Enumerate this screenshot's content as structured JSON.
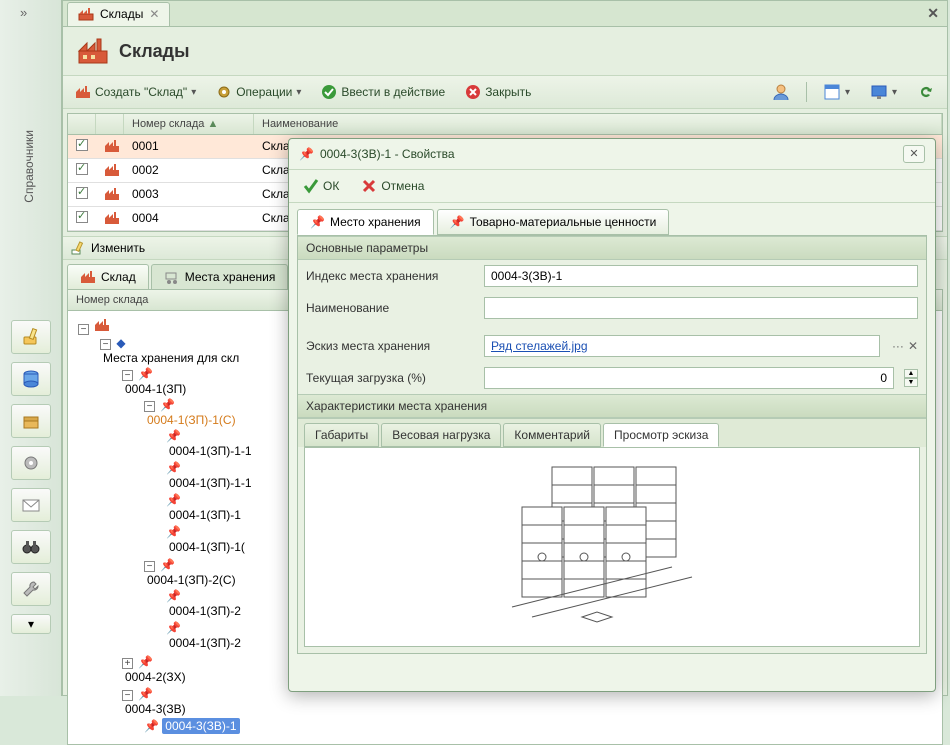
{
  "sidebar": {
    "label": "Справочники",
    "collapse": "»"
  },
  "mini_icons": [
    "edit",
    "db",
    "box",
    "gear",
    "mail",
    "binoc",
    "wrench",
    "dropdown"
  ],
  "tab": {
    "title": "Склады"
  },
  "page": {
    "title": "Склады"
  },
  "toolbar": {
    "create": "Создать \"Склад\"",
    "operations": "Операции",
    "activate": "Ввести в действие",
    "close": "Закрыть"
  },
  "grid": {
    "col_number": "Номер склада",
    "col_name": "Наименование",
    "rows": [
      {
        "num": "0001",
        "name": "Склад о"
      },
      {
        "num": "0002",
        "name": "Склад в"
      },
      {
        "num": "0003",
        "name": "Склад Н"
      },
      {
        "num": "0004",
        "name": "Склад го"
      }
    ]
  },
  "edit_button": "Изменить",
  "subtabs": {
    "warehouse": "Склад",
    "storage": "Места хранения"
  },
  "tree": {
    "header": "Номер склада",
    "root_places": "Места хранения для скл",
    "n1": "0004-1(ЗП)",
    "n1_1": "0004-1(ЗП)-1(С)",
    "n1_1_1": "0004-1(ЗП)-1-1",
    "n1_1_2": "0004-1(ЗП)-1-1",
    "n1_1_3": "0004-1(ЗП)-1",
    "n1_1_4": "0004-1(ЗП)-1(",
    "n1_2": "0004-1(ЗП)-2(С)",
    "n1_2_1": "0004-1(ЗП)-2",
    "n1_2_2": "0004-1(ЗП)-2",
    "n2": "0004-2(ЗХ)",
    "n3": "0004-3(ЗВ)",
    "n3_1": "0004-3(ЗВ)-1"
  },
  "dialog": {
    "title": "0004-3(ЗВ)-1 - Свойства",
    "ok": "ОК",
    "cancel": "Отмена",
    "tab_storage": "Место хранения",
    "tab_goods": "Товарно-материальные ценности",
    "section_main": "Основные параметры",
    "label_index": "Индекс места хранения",
    "value_index": "0004-3(ЗВ)-1",
    "label_name": "Наименование",
    "value_name": "",
    "label_sketch": "Эскиз места хранения",
    "value_sketch": "Ряд стелажей.jpg",
    "label_load": "Текущая загрузка (%)",
    "value_load": "0",
    "section_char": "Характеристики места хранения",
    "chartab_dims": "Габариты",
    "chartab_weight": "Весовая нагрузка",
    "chartab_comment": "Комментарий",
    "chartab_preview": "Просмотр эскиза"
  }
}
